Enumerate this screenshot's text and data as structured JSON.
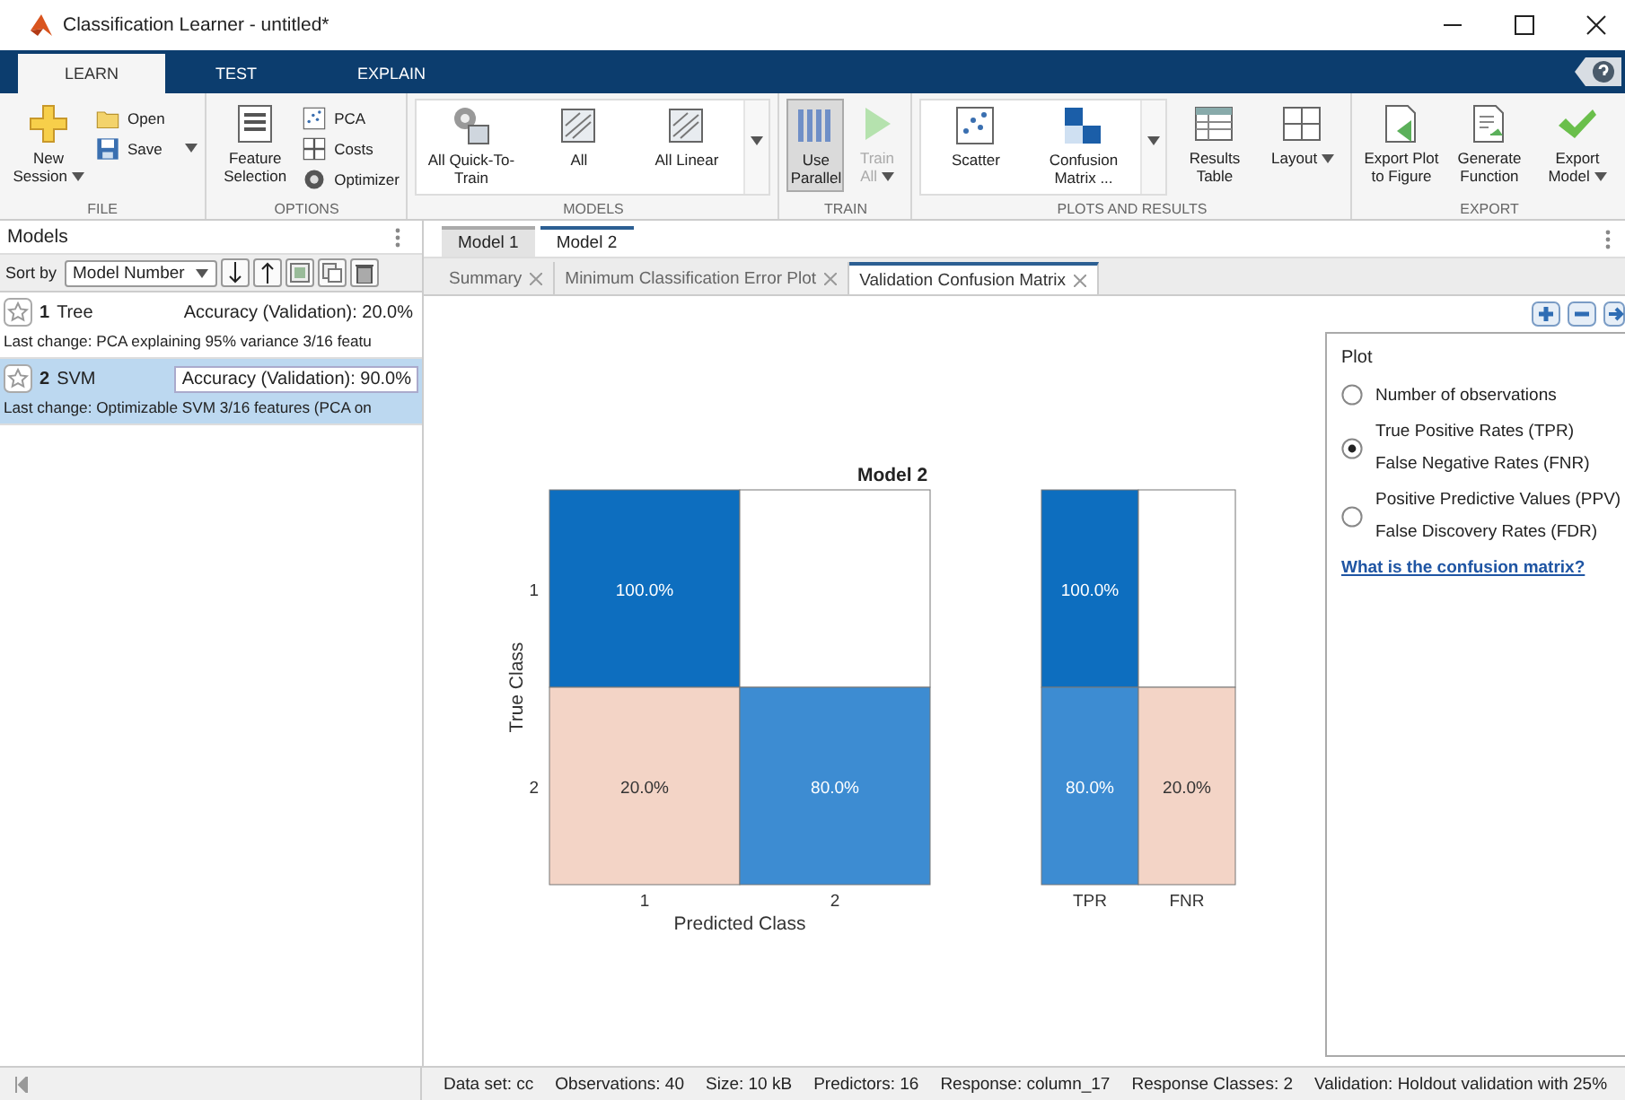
{
  "window": {
    "title": "Classification Learner - untitled*"
  },
  "ribbon_tabs": [
    {
      "label": "LEARN",
      "selected": true
    },
    {
      "label": "TEST",
      "selected": false
    },
    {
      "label": "EXPLAIN",
      "selected": false
    }
  ],
  "toolbar": [
    {
      "label": "FILE",
      "items": [
        {
          "kind": "large",
          "label": "New Session",
          "dropdown": true
        },
        {
          "kind": "small",
          "label": "Open",
          "dropdown": false
        },
        {
          "kind": "small",
          "label": "Save",
          "dropdown": true
        }
      ]
    },
    {
      "label": "OPTIONS",
      "items": [
        {
          "kind": "large",
          "label": "Feature Selection",
          "dropdown": false
        },
        {
          "kind": "small",
          "label": "PCA",
          "dropdown": false
        },
        {
          "kind": "small",
          "label": "Costs",
          "dropdown": false
        },
        {
          "kind": "small",
          "label": "Optimizer",
          "dropdown": false
        }
      ]
    },
    {
      "label": "MODELS",
      "items": [
        {
          "kind": "gallery",
          "label": "All Quick-To-Train",
          "dropdown": false
        },
        {
          "kind": "gallery",
          "label": "All",
          "dropdown": false
        },
        {
          "kind": "gallery",
          "label": "All Linear",
          "dropdown": false
        }
      ]
    },
    {
      "label": "TRAIN",
      "items": [
        {
          "kind": "large",
          "label": "Use Parallel",
          "dropdown": false,
          "pressed": true,
          "disabled": false
        },
        {
          "kind": "large",
          "label": "Train All",
          "dropdown": true,
          "pressed": false,
          "disabled": true
        }
      ]
    },
    {
      "label": "PLOTS AND RESULTS",
      "items": [
        {
          "kind": "gallery",
          "label": "Scatter",
          "dropdown": false
        },
        {
          "kind": "gallery",
          "label": "Confusion Matrix ...",
          "dropdown": false
        },
        {
          "kind": "large",
          "label": "Results Table",
          "dropdown": false
        },
        {
          "kind": "large",
          "label": "Layout",
          "dropdown": true
        }
      ]
    },
    {
      "label": "EXPORT",
      "items": [
        {
          "kind": "large",
          "label": "Export Plot to Figure",
          "dropdown": false
        },
        {
          "kind": "large",
          "label": "Generate Function",
          "dropdown": false
        },
        {
          "kind": "large",
          "label": "Export Model",
          "dropdown": true
        }
      ]
    }
  ],
  "models_panel": {
    "title": "Models",
    "sort_label": "Sort by",
    "sort_value": "Model Number",
    "models": [
      {
        "number": "1",
        "name": "Tree",
        "accuracy": "Accuracy (Validation): 20.0%",
        "last_change": "Last change: PCA explaining 95% variance  3/16 featu",
        "selected": false
      },
      {
        "number": "2",
        "name": "SVM",
        "accuracy": "Accuracy (Validation): 90.0%",
        "last_change": "Last change: Optimizable SVM  3/16 features (PCA on",
        "selected": true
      }
    ]
  },
  "document_tabs": [
    {
      "label": "Model 1",
      "selected": false
    },
    {
      "label": "Model 2",
      "selected": true
    }
  ],
  "plot_tabs": [
    {
      "label": "Summary",
      "selected": false
    },
    {
      "label": "Minimum Classification Error Plot",
      "selected": false
    },
    {
      "label": "Validation Confusion Matrix",
      "selected": true
    }
  ],
  "plot": {
    "title": "Model 2",
    "ylabel": "True Class",
    "xlabel": "Predicted Class",
    "row_labels": [
      "1",
      "2"
    ],
    "col_labels": [
      "1",
      "2"
    ],
    "cells": [
      [
        {
          "text": "100.0%",
          "color": "#0d6ebf"
        },
        {
          "color": "#ffffff"
        }
      ],
      [
        {
          "text": "20.0%",
          "color": "#f3d4c6"
        },
        {
          "text": "80.0%",
          "color": "#3d8cd2"
        }
      ]
    ],
    "summary_labels": [
      "TPR",
      "FNR"
    ],
    "summary_cells": [
      [
        {
          "text": "100.0%",
          "color": "#0d6ebf"
        },
        {
          "color": "#ffffff"
        }
      ],
      [
        {
          "text": "80.0%",
          "color": "#3d8cd2"
        },
        {
          "text": "20.0%",
          "color": "#f3d4c6"
        }
      ]
    ]
  },
  "plot_options": {
    "title": "Plot",
    "options": [
      {
        "lines": [
          "Number of observations"
        ],
        "selected": false
      },
      {
        "lines": [
          "True Positive Rates (TPR)",
          "False Negative Rates (FNR)"
        ],
        "selected": true
      },
      {
        "lines": [
          "Positive Predictive Values (PPV)",
          "False Discovery Rates (FDR)"
        ],
        "selected": false
      }
    ],
    "link": "What is the confusion matrix?"
  },
  "status_bar": [
    "Data set: cc",
    "Observations: 40",
    "Size: 10 kB",
    "Predictors: 16",
    "Response: column_17",
    "Response Classes: 2",
    "Validation: Holdout validation with 25%"
  ]
}
